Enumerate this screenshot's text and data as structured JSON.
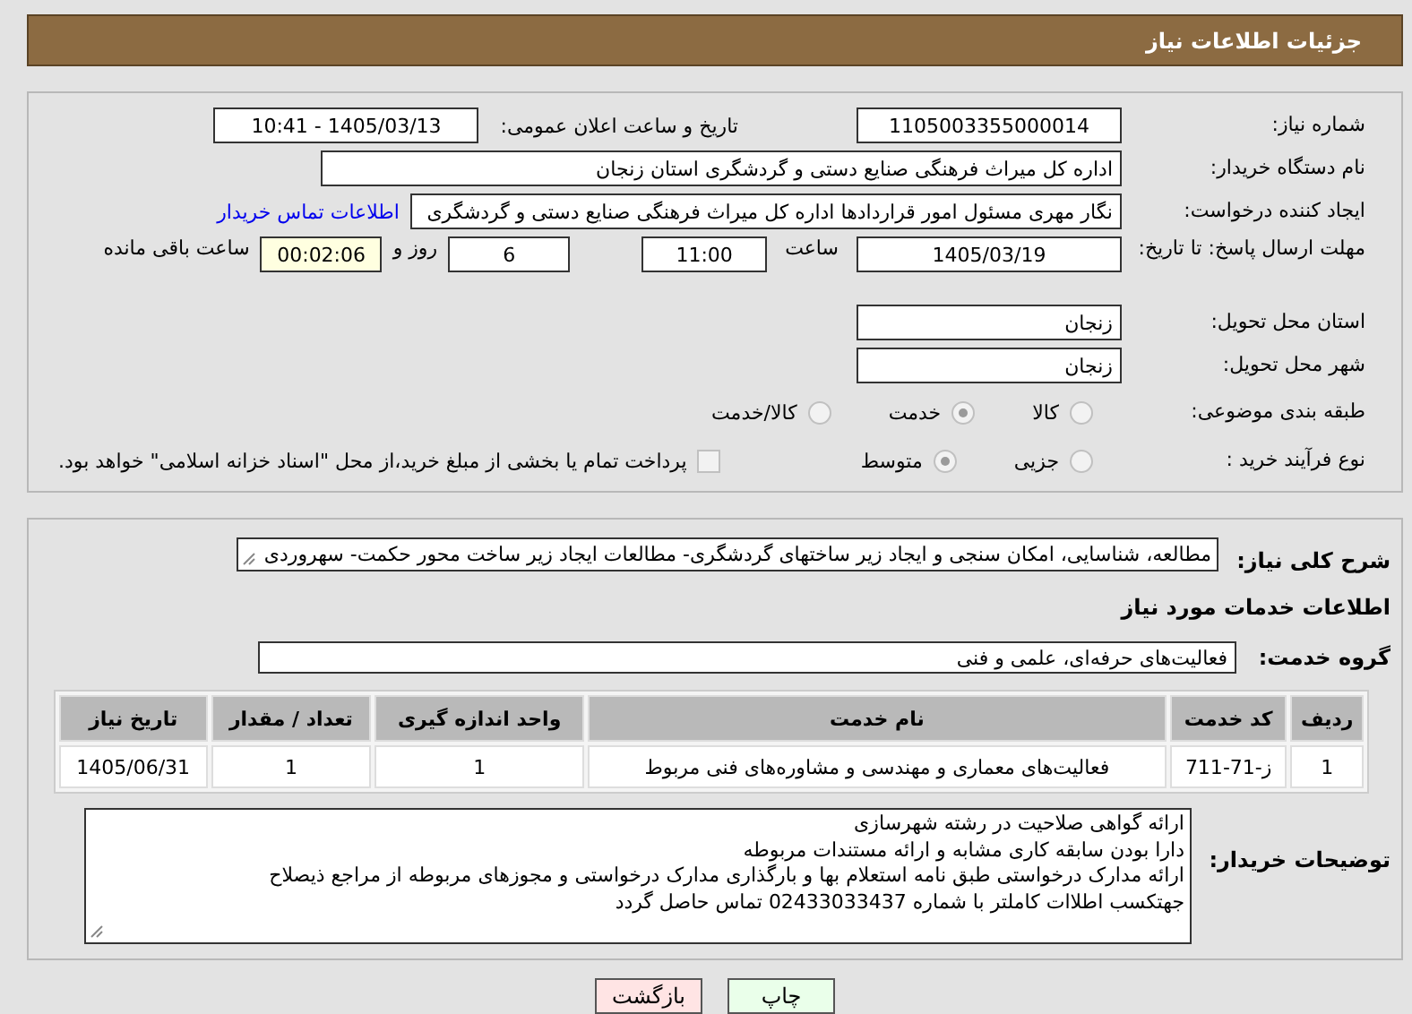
{
  "header": {
    "title": "جزئیات اطلاعات نیاز"
  },
  "need_info": {
    "need_number": {
      "label": "شماره نیاز:",
      "value": "1105003355000014"
    },
    "announce_datetime": {
      "label": "تاریخ و ساعت اعلان عمومی:",
      "value": "1405/03/13 - 10:41"
    },
    "buyer_org": {
      "label": "نام دستگاه خریدار:",
      "value": "اداره کل میراث فرهنگی  صنایع دستی و گردشگری استان زنجان"
    },
    "requester": {
      "label": "ایجاد کننده درخواست:",
      "value": "نگار مهری مسئول امور قراردادها اداره کل میراث فرهنگی  صنایع دستی و گردشگری",
      "link": "اطلاعات تماس خریدار"
    },
    "deadline": {
      "label": "مهلت ارسال پاسخ: تا تاریخ:",
      "date": "1405/03/19",
      "time_label": "ساعت",
      "time": "11:00",
      "days": "6",
      "days_label": "روز و",
      "remaining": "00:02:06",
      "remaining_label": "ساعت باقی مانده"
    },
    "province": {
      "label": "استان محل تحویل:",
      "value": "زنجان"
    },
    "city": {
      "label": "شهر محل تحویل:",
      "value": "زنجان"
    },
    "category": {
      "label": "طبقه بندی موضوعی:",
      "options": [
        {
          "label": "کالا",
          "selected": false
        },
        {
          "label": "خدمت",
          "selected": true
        },
        {
          "label": "کالا/خدمت",
          "selected": false
        }
      ]
    },
    "process": {
      "label": "نوع فرآیند خرید :",
      "options": [
        {
          "label": "جزیی",
          "selected": false
        },
        {
          "label": "متوسط",
          "selected": true
        }
      ],
      "payment": {
        "label": "پرداخت تمام یا بخشی از مبلغ خرید،از محل \"اسناد خزانه اسلامی\" خواهد بود.",
        "checked": false
      }
    }
  },
  "details": {
    "description": {
      "label": "شرح کلی نیاز:",
      "value": "مطالعه، شناسایی، امکان سنجی و ایجاد زیر ساختهای گردشگری- مطالعات ایجاد زیر ساخت محور حکمت- سهروردی"
    },
    "services_heading": "اطلاعات خدمات مورد نیاز",
    "service_group": {
      "label": "گروه خدمت:",
      "value": "فعالیت‌های حرفه‌ای، علمی و فنی"
    },
    "table": {
      "columns": [
        "ردیف",
        "کد خدمت",
        "نام خدمت",
        "واحد اندازه گیری",
        "تعداد / مقدار",
        "تاریخ نیاز"
      ],
      "rows": [
        [
          "1",
          "ز-71-711",
          "فعالیت‌های معماری و مهندسی و مشاوره‌های فنی مربوط",
          "1",
          "1",
          "1405/06/31"
        ]
      ]
    },
    "buyer_notes": {
      "label": "توضیحات خریدار:",
      "lines": [
        "ارائه گواهی صلاحیت در رشته شهرسازی",
        "دارا بودن سابقه کاری مشابه و ارائه مستندات مربوطه",
        "ارائه مدارک درخواستی طبق نامه استعلام بها و بارگذاری مدارک درخواستی و مجوزهای مربوطه از مراجع ذیصلاح",
        "جهتکسب اطلاات کاملتر با شماره 02433033437 تماس حاصل گردد"
      ]
    }
  },
  "buttons": [
    {
      "label": "چاپ",
      "kind": "print"
    },
    {
      "label": "بازگشت",
      "kind": "back"
    }
  ]
}
